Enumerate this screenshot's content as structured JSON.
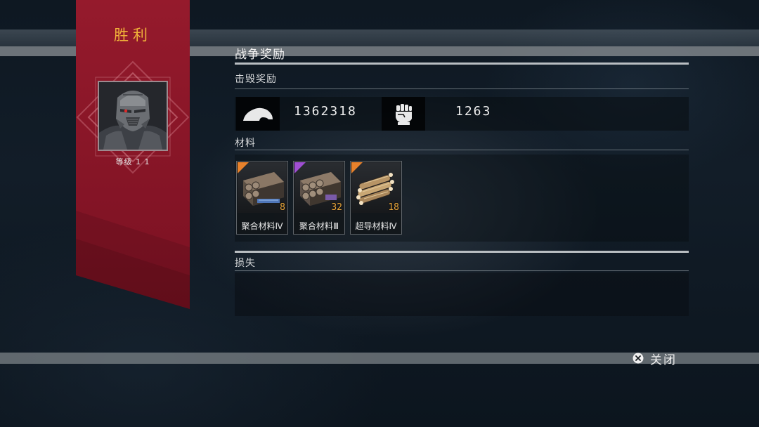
{
  "banner": {
    "title": "胜利",
    "level_label": "等级 1 1",
    "color": "#8e1628"
  },
  "panel": {
    "title": "战争奖励",
    "kill_reward_label": "击毁奖励",
    "materials_label": "材料",
    "loss_label": "损失"
  },
  "kill_rewards": [
    {
      "icon": "credits-icon",
      "value": "1362318"
    },
    {
      "icon": "fist-icon",
      "value": "1263"
    }
  ],
  "materials": [
    {
      "name": "聚合材料Ⅳ",
      "count": "8",
      "rarity_color": "#e8822c"
    },
    {
      "name": "聚合材料Ⅲ",
      "count": "32",
      "rarity_color": "#9f4fd2"
    },
    {
      "name": "超导材料Ⅳ",
      "count": "18",
      "rarity_color": "#e8822c"
    }
  ],
  "close_button": {
    "icon": "x-circle-icon",
    "label": "关闭"
  }
}
